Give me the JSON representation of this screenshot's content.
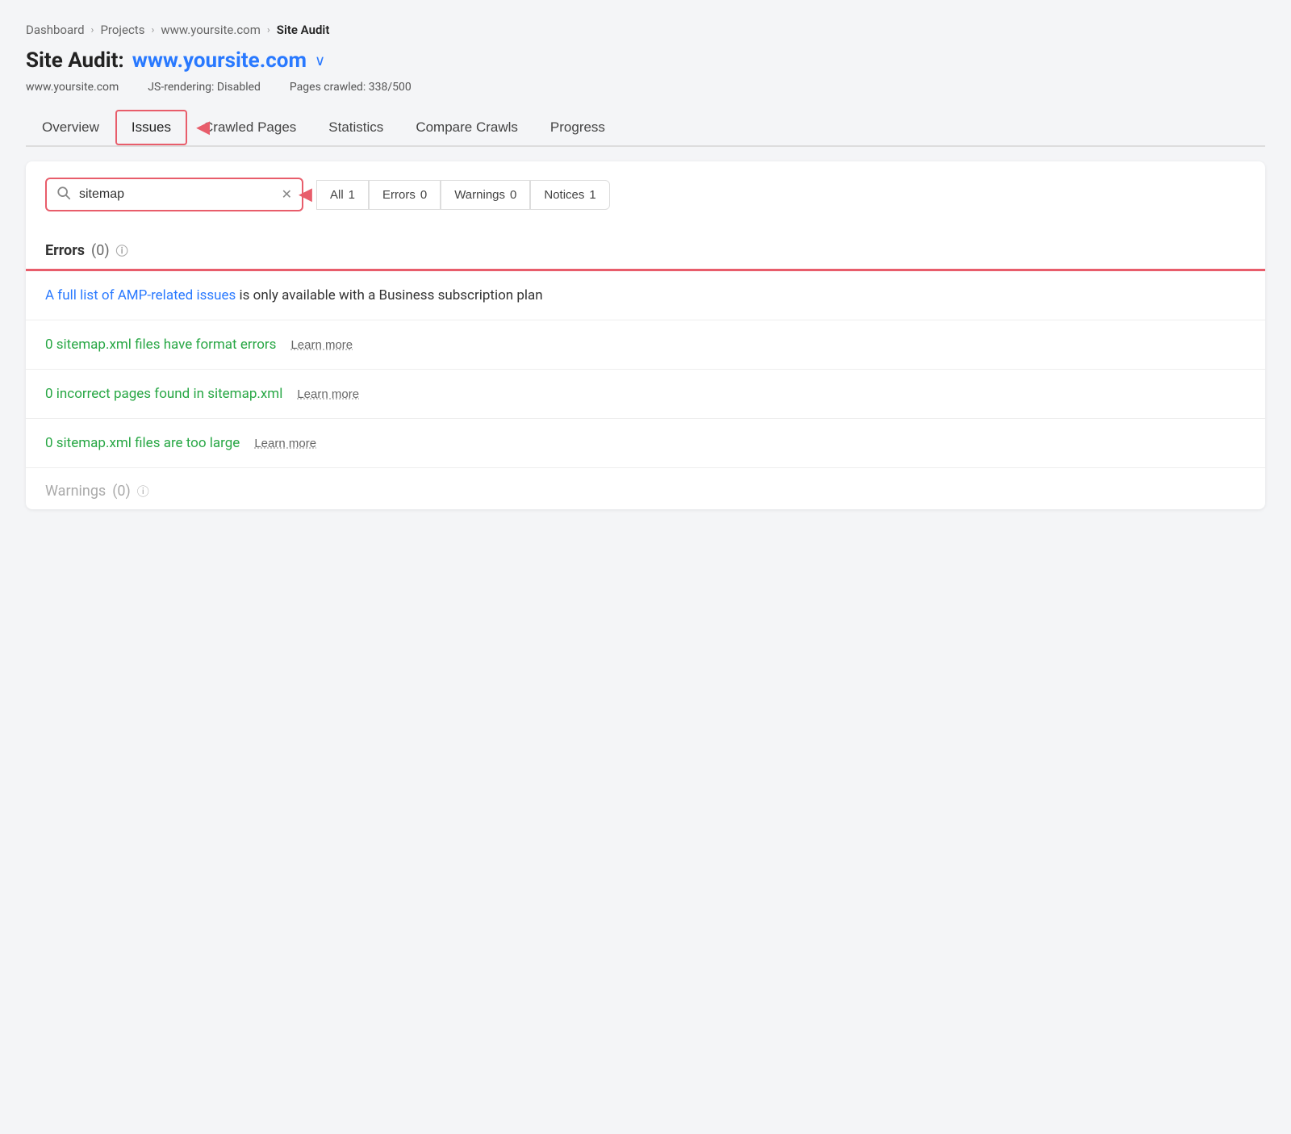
{
  "breadcrumb": {
    "items": [
      {
        "label": "Dashboard",
        "active": false
      },
      {
        "label": "Projects",
        "active": false
      },
      {
        "label": "www.yoursite.com",
        "active": false
      },
      {
        "label": "Site Audit",
        "active": true
      }
    ],
    "separators": [
      ">",
      ">",
      ">"
    ]
  },
  "page_title": {
    "prefix": "Site Audit:",
    "site": "www.yoursite.com",
    "dropdown_char": "∨"
  },
  "site_meta": {
    "url": "www.yoursite.com",
    "js_rendering": "JS-rendering: Disabled",
    "pages_crawled": "Pages crawled: 338/500"
  },
  "nav": {
    "tabs": [
      {
        "label": "Overview",
        "active": false,
        "outlined": false
      },
      {
        "label": "Issues",
        "active": true,
        "outlined": true
      },
      {
        "label": "Crawled Pages",
        "active": false,
        "outlined": false
      },
      {
        "label": "Statistics",
        "active": false,
        "outlined": false
      },
      {
        "label": "Compare Crawls",
        "active": false,
        "outlined": false
      },
      {
        "label": "Progress",
        "active": false,
        "outlined": false
      }
    ]
  },
  "filter": {
    "search_placeholder": "sitemap",
    "search_value": "sitemap",
    "buttons": [
      {
        "label": "All",
        "count": "1",
        "active": true
      },
      {
        "label": "Errors",
        "count": "0",
        "active": false
      },
      {
        "label": "Warnings",
        "count": "0",
        "active": false
      },
      {
        "label": "Notices",
        "count": "1",
        "active": false
      }
    ]
  },
  "sections": {
    "errors": {
      "label": "Errors",
      "count": "(0)",
      "issues": [
        {
          "type": "amp",
          "link_text": "A full list of AMP-related issues",
          "suffix_text": " is only available with a Business subscription plan",
          "learn_more": null
        },
        {
          "type": "green",
          "text": "0 sitemap.xml files have format errors",
          "learn_more": "Learn more"
        },
        {
          "type": "green",
          "text": "0 incorrect pages found in sitemap.xml",
          "learn_more": "Learn more"
        },
        {
          "type": "green",
          "text": "0 sitemap.xml files are too large",
          "learn_more": "Learn more"
        }
      ]
    },
    "warnings": {
      "label": "Warnings",
      "count": "(0)"
    }
  }
}
